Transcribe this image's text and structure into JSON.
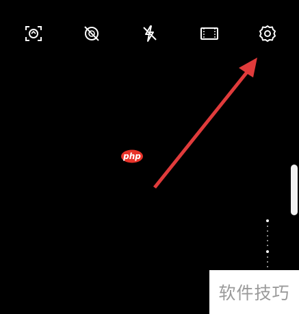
{
  "toolbar": {
    "icons": [
      "ai-scene-icon",
      "hdr-off-icon",
      "flash-off-icon",
      "aspect-ratio-icon",
      "settings-gear-icon"
    ]
  },
  "annotation": {
    "arrow_color": "#e03b3b",
    "badge_text": "php",
    "badge_color": "#e8332a"
  },
  "watermark": {
    "text": "软件技巧"
  }
}
